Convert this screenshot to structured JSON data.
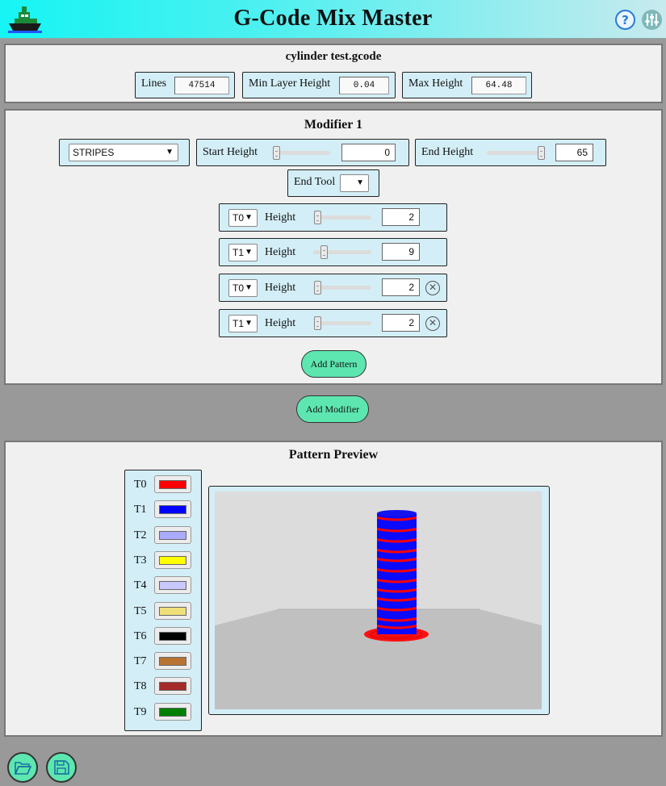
{
  "header": {
    "title": "G-Code Mix Master",
    "help_icon": "question-circle-icon",
    "settings_icon": "sliders-icon",
    "logo_icon": "boat-logo-icon"
  },
  "file": {
    "name": "cylinder test.gcode",
    "lines_label": "Lines",
    "lines_value": "47514",
    "min_layer_label": "Min Layer Height",
    "min_layer_value": "0.04",
    "max_height_label": "Max Height",
    "max_height_value": "64.48"
  },
  "modifier": {
    "title": "Modifier 1",
    "type_value": "STRIPES",
    "start_label": "Start Height",
    "start_value": "0",
    "end_label": "End Height",
    "end_value": "65",
    "end_tool_label": "End Tool",
    "end_tool_value": "",
    "patterns": [
      {
        "tool": "T0",
        "label": "Height",
        "value": "2",
        "slider_fraction": 0.02,
        "removable": false
      },
      {
        "tool": "T1",
        "label": "Height",
        "value": "9",
        "slider_fraction": 0.14,
        "removable": false
      },
      {
        "tool": "T0",
        "label": "Height",
        "value": "2",
        "slider_fraction": 0.02,
        "removable": true
      },
      {
        "tool": "T1",
        "label": "Height",
        "value": "2",
        "slider_fraction": 0.02,
        "removable": true
      }
    ],
    "add_pattern_label": "Add Pattern"
  },
  "add_modifier_label": "Add Modifier",
  "preview": {
    "title": "Pattern Preview",
    "tools": [
      {
        "name": "T0",
        "color": "#ff0000"
      },
      {
        "name": "T1",
        "color": "#0000ff"
      },
      {
        "name": "T2",
        "color": "#aaaaff"
      },
      {
        "name": "T3",
        "color": "#ffff00"
      },
      {
        "name": "T4",
        "color": "#c8c8ff"
      },
      {
        "name": "T5",
        "color": "#f0e07a"
      },
      {
        "name": "T6",
        "color": "#000000"
      },
      {
        "name": "T7",
        "color": "#b87333"
      },
      {
        "name": "T8",
        "color": "#a52a2a"
      },
      {
        "name": "T9",
        "color": "#008000"
      }
    ]
  },
  "footer": {
    "open_icon": "folder-open-icon",
    "save_icon": "save-disk-icon"
  }
}
